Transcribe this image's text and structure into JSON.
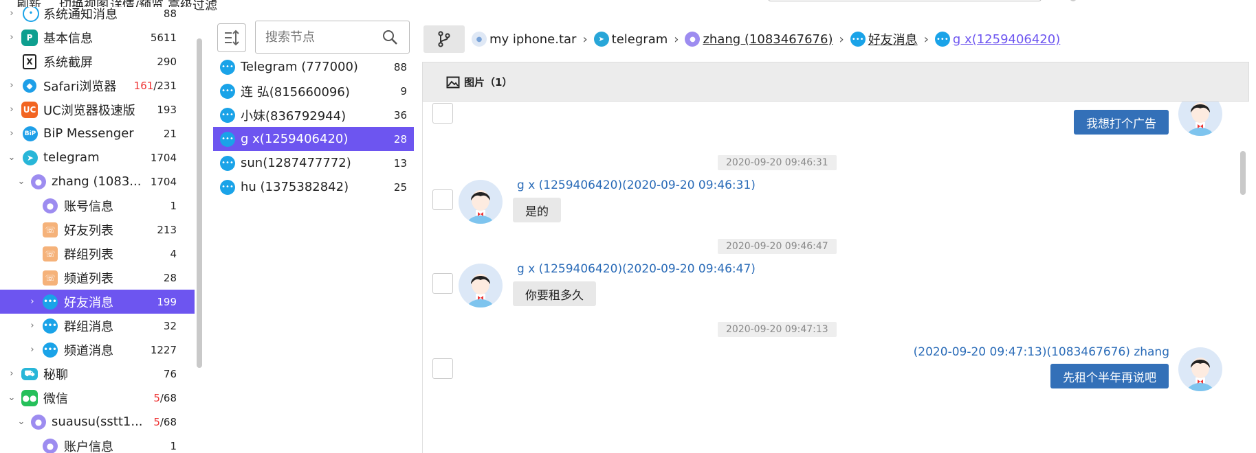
{
  "toolbar": {
    "refresh": "刷新",
    "switch_view": "切换视图",
    "detail_preview": "详情/预览",
    "advanced_filter": "高级过滤"
  },
  "tree": {
    "items": [
      {
        "label": "系统通知消息",
        "count": "88",
        "icon": "bell-bubble-icon",
        "arrow": "›"
      },
      {
        "label": "基本信息",
        "count": "5611",
        "icon": "info-icon",
        "arrow": "›"
      },
      {
        "label": "系统截屏",
        "count": "290",
        "icon": "screenshot-icon",
        "arrow": ""
      },
      {
        "label": "Safari浏览器",
        "count_red": "161",
        "count_rest": "/231",
        "icon": "safari-icon",
        "arrow": "›"
      },
      {
        "label": "UC浏览器极速版",
        "count": "193",
        "icon": "uc-browser-icon",
        "arrow": "›"
      },
      {
        "label": "BiP Messenger",
        "count": "21",
        "icon": "bip-icon",
        "arrow": "›"
      },
      {
        "label": "telegram",
        "count": "1704",
        "icon": "telegram-icon",
        "arrow": "⌄"
      },
      {
        "label": "zhang (1083...",
        "count": "1704",
        "icon": "user-icon",
        "arrow": "⌄"
      },
      {
        "label": "账号信息",
        "count": "1",
        "icon": "user-icon",
        "arrow": ""
      },
      {
        "label": "好友列表",
        "count": "213",
        "icon": "contacts-icon",
        "arrow": ""
      },
      {
        "label": "群组列表",
        "count": "4",
        "icon": "contacts-icon",
        "arrow": ""
      },
      {
        "label": "频道列表",
        "count": "28",
        "icon": "contacts-icon",
        "arrow": ""
      },
      {
        "label": "好友消息",
        "count": "199",
        "icon": "chat-bubble-icon",
        "arrow": "›"
      },
      {
        "label": "群组消息",
        "count": "32",
        "icon": "chat-bubble-icon",
        "arrow": "›"
      },
      {
        "label": "频道消息",
        "count": "1227",
        "icon": "chat-bubble-icon",
        "arrow": "›"
      },
      {
        "label": "秘聊",
        "count": "76",
        "icon": "secret-chat-icon",
        "arrow": "›"
      },
      {
        "label": "微信",
        "count_red": "5",
        "count_rest": "/68",
        "icon": "wechat-icon",
        "arrow": "⌄"
      },
      {
        "label": "suausu(sstt1...",
        "count_red": "5",
        "count_rest": "/68",
        "icon": "user-icon",
        "arrow": "⌄"
      },
      {
        "label": "账户信息",
        "count": "1",
        "icon": "user-icon",
        "arrow": ""
      }
    ]
  },
  "middle": {
    "search_placeholder": "搜索节点",
    "items": [
      {
        "label": "Telegram (777000)",
        "count": "88"
      },
      {
        "label": "连 弘(815660096)",
        "count": "9"
      },
      {
        "label": "小妹(836792944)",
        "count": "36"
      },
      {
        "label": "g x(1259406420)",
        "count": "28"
      },
      {
        "label": "sun(1287477772)",
        "count": "13"
      },
      {
        "label": "hu (1375382842)",
        "count": "25"
      }
    ]
  },
  "breadcrumb": {
    "items": [
      {
        "label": "my iphone.tar"
      },
      {
        "label": "telegram"
      },
      {
        "label": "zhang (1083467676)"
      },
      {
        "label": "好友消息"
      },
      {
        "label": "g x(1259406420)"
      }
    ],
    "separator": "›"
  },
  "tab": {
    "label": "图片（1）"
  },
  "messages": [
    {
      "type": "out",
      "text": "我想打个广告"
    },
    {
      "type": "time",
      "text": "2020-09-20 09:46:31"
    },
    {
      "type": "in",
      "sender": "g x (1259406420)(2020-09-20 09:46:31)",
      "text": "是的"
    },
    {
      "type": "time",
      "text": "2020-09-20 09:46:47"
    },
    {
      "type": "in",
      "sender": "g x (1259406420)(2020-09-20 09:46:47)",
      "text": "你要租多久"
    },
    {
      "type": "time",
      "text": "2020-09-20 09:47:13"
    },
    {
      "type": "out",
      "sender": "(2020-09-20 09:47:13)(1083467676) zhang",
      "text": "先租个半年再说吧"
    }
  ]
}
